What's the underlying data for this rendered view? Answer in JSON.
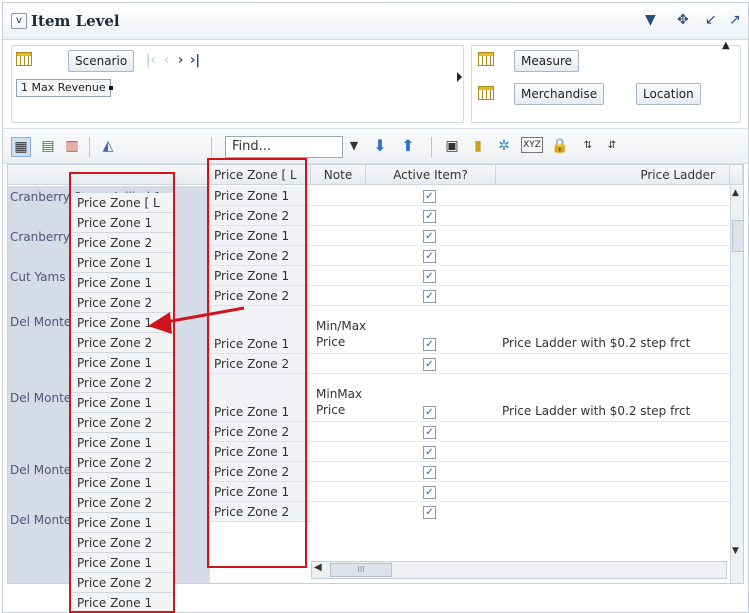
{
  "header": {
    "title": "Item Level"
  },
  "pov": {
    "scenario_label": "Scenario",
    "scenario_value": "1 Max Revenue",
    "measure_label": "Measure",
    "merchandise_label": "Merchandise",
    "location_label": "Location"
  },
  "toolbar": {
    "find_value": "Find..."
  },
  "columns": {
    "price_zone": "Price Zone [ L",
    "note": "Note",
    "active": "Active Item?",
    "ladder": "Price Ladder"
  },
  "row_labels": [
    "Cranberry Sauce Jellied 1",
    "Cranberry Sauce Whole B",
    "Cut Yams 15 oz",
    "Del Monte Diced Peaches",
    "Del Monte Diced Peaches",
    "Del Monte Diced Tomatoe",
    "Del Monte Diced Tomatoe"
  ],
  "price_zones": [
    "Price Zone 1",
    "Price Zone 2",
    "Price Zone 1",
    "Price Zone 2",
    "Price Zone 1",
    "Price Zone 2",
    "Price Zone 1",
    "Price Zone 2",
    "Price Zone 1",
    "Price Zone 2",
    "Price Zone 1",
    "Price Zone 2",
    "Price Zone 1",
    "Price Zone 2"
  ],
  "notes": {
    "row5a": "Min/Max",
    "row5b": "Price",
    "row7a": "MinMax",
    "row7b": "Price"
  },
  "ladders": {
    "row5": "Price Ladder with $0.2 step frct",
    "row7": "Price Ladder with $0.2 step frct"
  },
  "overlay": {
    "header": "Price Zone [ L",
    "items": [
      "Price Zone 1",
      "Price Zone 2",
      "Price Zone 1",
      "Price Zone 1",
      "Price Zone 2",
      "Price Zone 1",
      "Price Zone 2",
      "Price Zone 1",
      "Price Zone 2",
      "Price Zone 1",
      "Price Zone 2",
      "Price Zone 1",
      "Price Zone 2"
    ],
    "tail": "Price Zone 2"
  },
  "colors": {
    "annotation": "#d0141c",
    "row_header_bg": "#d6dbe8"
  },
  "checkbox_glyph": "✓",
  "scroll_glyph": "III"
}
